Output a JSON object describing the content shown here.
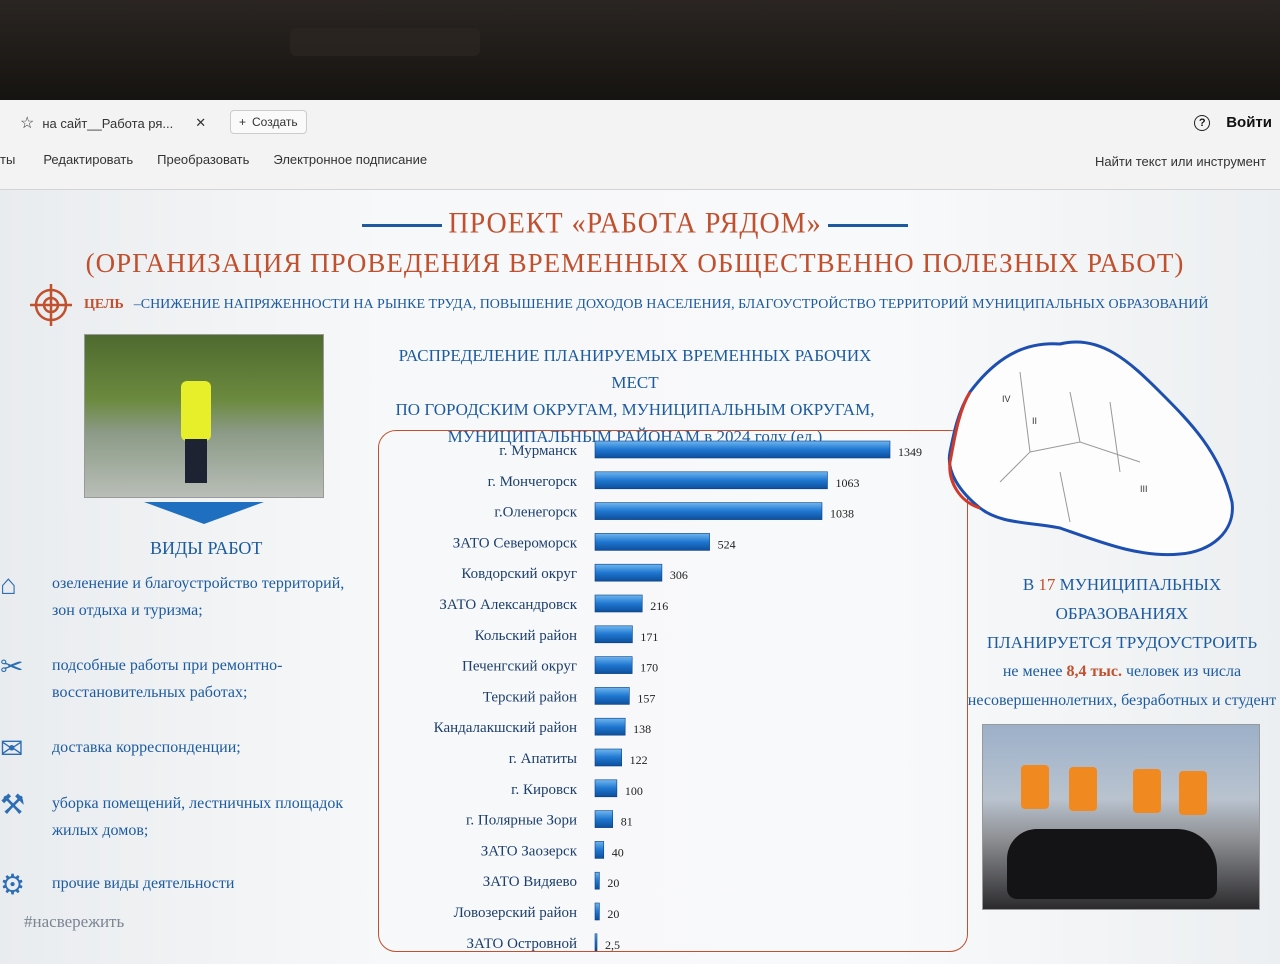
{
  "browser": {
    "tab_title": "на сайт__Работа ря...",
    "new_tab_label": "Создать",
    "login_label": "Войти",
    "help_symbol": "?",
    "menu": [
      "ты",
      "Редактировать",
      "Преобразовать",
      "Электронное подписание"
    ],
    "find_tool": "Найти текст или инструмент"
  },
  "slide": {
    "title": "ПРОЕКТ «РАБОТА РЯДОМ»",
    "subtitle": "(ОРГАНИЗАЦИЯ ПРОВЕДЕНИЯ ВРЕМЕННЫХ ОБЩЕСТВЕННО ПОЛЕЗНЫХ РАБОТ)",
    "goal_label": "ЦЕЛЬ",
    "goal_text": "–СНИЖЕНИЕ НАПРЯЖЕННОСТИ НА РЫНКЕ ТРУДА, ПОВЫШЕНИЕ ДОХОДОВ НАСЕЛЕНИЯ, БЛАГОУСТРОЙСТВО ТЕРРИТОРИЙ МУНИЦИПАЛЬНЫХ ОБРАЗОВАНИЙ",
    "work_types_title": "ВИДЫ РАБОТ",
    "work_types": [
      {
        "icon": "park-icon",
        "text": "озеленение и благоустройство территорий, зон отдыха и туризма;"
      },
      {
        "icon": "tools-icon",
        "text": "подсобные работы при ремонтно-восстановительных работах;"
      },
      {
        "icon": "mail-icon",
        "text": "доставка корреспонденции;"
      },
      {
        "icon": "cleaning-icon",
        "text": "уборка помещений, лестничных площадок жилых домов;"
      },
      {
        "icon": "misc-icon",
        "text": "прочие виды деятельности"
      }
    ],
    "hashtag": "#насвережить",
    "chart_title_lines": [
      "РАСПРЕДЕЛЕНИЕ ПЛАНИРУЕМЫХ ВРЕМЕННЫХ РАБОЧИХ МЕСТ",
      "ПО ГОРОДСКИМ ОКРУГАМ, МУНИЦИПАЛЬНЫМ ОКРУГАМ,",
      "МУНИЦИПАЛЬНЫМ РАЙОНАМ в 2024 году (ед.)"
    ],
    "note": {
      "line1_pre": "В ",
      "line1_num": "17",
      "line1_post": " МУНИЦИПАЛЬНЫХ ОБРАЗОВАНИЯХ",
      "line2": "ПЛАНИРУЕТСЯ ТРУДОУСТРОИТЬ",
      "line3_pre": "не менее ",
      "line3_num": "8,4 тыс.",
      "line3_post": " человек из числа",
      "line4": "несовершеннолетних, безработных и студент"
    }
  },
  "chart_data": {
    "type": "bar",
    "orientation": "horizontal",
    "categories": [
      "г. Мурманск",
      "г. Мончегорск",
      "г.Оленегорск",
      "ЗАТО Североморск",
      "Ковдорский округ",
      "ЗАТО Александровск",
      "Кольский район",
      "Печенгский округ",
      "Терский район",
      "Кандалакшский район",
      "г. Апатиты",
      "г. Кировск",
      "г. Полярные Зори",
      "ЗАТО Заозерск",
      "ЗАТО Видяево",
      "Ловозерский район",
      "ЗАТО Островной"
    ],
    "values": [
      1349,
      1063,
      1038,
      524,
      306,
      216,
      171,
      170,
      157,
      138,
      122,
      100,
      81,
      40,
      20,
      20,
      2.5
    ],
    "value_labels": [
      "1349",
      "1063",
      "1038",
      "524",
      "306",
      "216",
      "171",
      "170",
      "157",
      "138",
      "122",
      "100",
      "81",
      "40",
      "20",
      "20",
      "2,5"
    ],
    "bar_color": "#1f77d0",
    "xlim": [
      0,
      1349
    ],
    "grid": false
  },
  "colors": {
    "accent": "#c0502e",
    "text_blue": "#1d5ba0",
    "bar": "#1f77d0"
  }
}
